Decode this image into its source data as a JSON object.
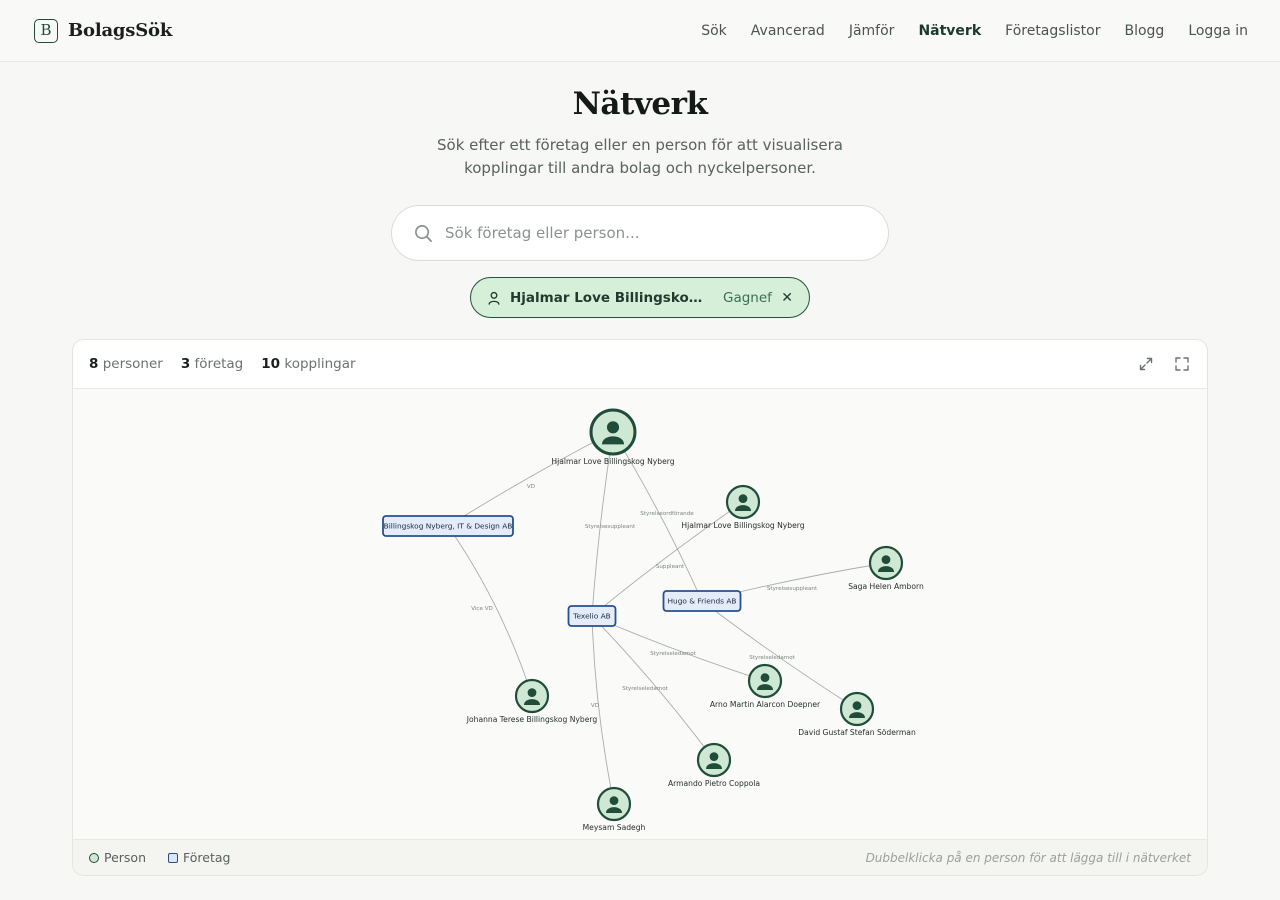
{
  "brand": {
    "name": "BolagsSök",
    "mark": "B"
  },
  "nav": [
    {
      "label": "Sök"
    },
    {
      "label": "Avancerad"
    },
    {
      "label": "Jämför"
    },
    {
      "label": "Nätverk",
      "active": true
    },
    {
      "label": "Företagslistor"
    },
    {
      "label": "Blogg"
    },
    {
      "label": "Logga in"
    }
  ],
  "hero": {
    "title": "Nätverk",
    "subtitle": "Sök efter ett företag eller en person för att visualisera kopplingar till andra bolag och nyckelpersoner."
  },
  "search": {
    "placeholder": "Sök företag eller person...",
    "icon": "search-icon"
  },
  "chip": {
    "name": "Hjalmar Love Billingskog Nyb...",
    "place": "Gagnef",
    "icon": "person-icon"
  },
  "stats": {
    "persons_count": "8",
    "persons_label": "personer",
    "companies_count": "3",
    "companies_label": "företag",
    "links_count": "10",
    "links_label": "kopplingar"
  },
  "legend": {
    "person": "Person",
    "company": "Företag"
  },
  "hint": "Dubbelklicka på en person för att lägga till i nätverket",
  "colors": {
    "accent": "#1f4d3a",
    "person_fill": "#cfe8d4",
    "company_stroke": "#26508e",
    "company_fill": "#e3ecf8",
    "chip_fill": "#d6efd9"
  },
  "graph": {
    "nodes": [
      {
        "id": "hjalmar_main",
        "type": "person",
        "label": "Hjalmar Love Billingskog Nyberg",
        "primary": true
      },
      {
        "id": "bn_it",
        "type": "company",
        "label": "Billingskog Nyberg, IT & Design AB"
      },
      {
        "id": "hjalmar_2",
        "type": "person",
        "label": "Hjalmar Love Billingskog Nyberg"
      },
      {
        "id": "texelio",
        "type": "company",
        "label": "Texelio AB"
      },
      {
        "id": "hugo",
        "type": "company",
        "label": "Hugo & Friends AB"
      },
      {
        "id": "saga",
        "type": "person",
        "label": "Saga Helen Amborn"
      },
      {
        "id": "johanna",
        "type": "person",
        "label": "Johanna Terese Billingskog Nyberg"
      },
      {
        "id": "arno",
        "type": "person",
        "label": "Arno Martin Alarcon Doepner"
      },
      {
        "id": "david",
        "type": "person",
        "label": "David Gustaf Stefan Söderman"
      },
      {
        "id": "armando",
        "type": "person",
        "label": "Armando Pietro Coppola"
      },
      {
        "id": "meysam",
        "type": "person",
        "label": "Meysam Sadegh"
      }
    ],
    "edges": [
      {
        "from": "hjalmar_main",
        "to": "bn_it",
        "label": "VD"
      },
      {
        "from": "hjalmar_main",
        "to": "texelio",
        "label": "Styrelsesuppleant"
      },
      {
        "from": "hjalmar_main",
        "to": "hugo",
        "label": "Styrelseordförande"
      },
      {
        "from": "hjalmar_2",
        "to": "texelio",
        "label": "Suppleant"
      },
      {
        "from": "saga",
        "to": "hugo",
        "label": "Styrelsesuppleant"
      },
      {
        "from": "bn_it",
        "to": "johanna",
        "label": "Vice VD"
      },
      {
        "from": "texelio",
        "to": "arno",
        "label": "Styrelseledamot"
      },
      {
        "from": "hugo",
        "to": "david",
        "label": "Styrelseledamot"
      },
      {
        "from": "texelio",
        "to": "armando",
        "label": "Styrelseledamot"
      },
      {
        "from": "texelio",
        "to": "meysam",
        "label": "VD"
      }
    ]
  }
}
